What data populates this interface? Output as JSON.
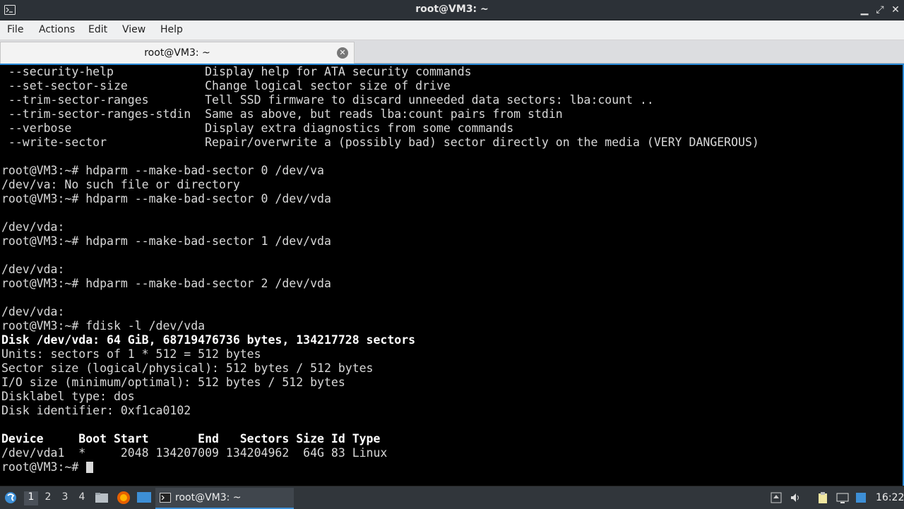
{
  "window": {
    "title": "root@VM3: ~",
    "controls": {
      "minimize": "▁",
      "maximize": "⤢",
      "close": "✕"
    }
  },
  "menu": [
    "File",
    "Actions",
    "Edit",
    "View",
    "Help"
  ],
  "tab": {
    "label": "root@VM3: ~",
    "close_icon": "✕"
  },
  "terminal": {
    "lines": [
      {
        "text": " --security-help             Display help for ATA security commands",
        "bold": false
      },
      {
        "text": " --set-sector-size           Change logical sector size of drive",
        "bold": false
      },
      {
        "text": " --trim-sector-ranges        Tell SSD firmware to discard unneeded data sectors: lba:count ..",
        "bold": false
      },
      {
        "text": " --trim-sector-ranges-stdin  Same as above, but reads lba:count pairs from stdin",
        "bold": false
      },
      {
        "text": " --verbose                   Display extra diagnostics from some commands",
        "bold": false
      },
      {
        "text": " --write-sector              Repair/overwrite a (possibly bad) sector directly on the media (VERY DANGEROUS)",
        "bold": false
      },
      {
        "text": "",
        "bold": false
      },
      {
        "text": "root@VM3:~# hdparm --make-bad-sector 0 /dev/va",
        "bold": false
      },
      {
        "text": "/dev/va: No such file or directory",
        "bold": false
      },
      {
        "text": "root@VM3:~# hdparm --make-bad-sector 0 /dev/vda",
        "bold": false
      },
      {
        "text": "",
        "bold": false
      },
      {
        "text": "/dev/vda:",
        "bold": false
      },
      {
        "text": "root@VM3:~# hdparm --make-bad-sector 1 /dev/vda",
        "bold": false
      },
      {
        "text": "",
        "bold": false
      },
      {
        "text": "/dev/vda:",
        "bold": false
      },
      {
        "text": "root@VM3:~# hdparm --make-bad-sector 2 /dev/vda",
        "bold": false
      },
      {
        "text": "",
        "bold": false
      },
      {
        "text": "/dev/vda:",
        "bold": false
      },
      {
        "text": "root@VM3:~# fdisk -l /dev/vda",
        "bold": false
      },
      {
        "text": "Disk /dev/vda: 64 GiB, 68719476736 bytes, 134217728 sectors",
        "bold": true
      },
      {
        "text": "Units: sectors of 1 * 512 = 512 bytes",
        "bold": false
      },
      {
        "text": "Sector size (logical/physical): 512 bytes / 512 bytes",
        "bold": false
      },
      {
        "text": "I/O size (minimum/optimal): 512 bytes / 512 bytes",
        "bold": false
      },
      {
        "text": "Disklabel type: dos",
        "bold": false
      },
      {
        "text": "Disk identifier: 0xf1ca0102",
        "bold": false
      },
      {
        "text": "",
        "bold": false
      },
      {
        "text": "Device     Boot Start       End   Sectors Size Id Type",
        "bold": true
      },
      {
        "text": "/dev/vda1  *     2048 134207009 134204962  64G 83 Linux",
        "bold": false
      },
      {
        "text": "root@VM3:~# ",
        "bold": false
      }
    ]
  },
  "taskbar": {
    "workspaces": [
      "1",
      "2",
      "3",
      "4"
    ],
    "active_workspace": "1",
    "window_button": "root@VM3: ~",
    "clock": "16:22"
  },
  "colors": {
    "accent": "#2a8ad8",
    "terminal_bg": "#000000",
    "terminal_fg": "#d9d9d9"
  }
}
